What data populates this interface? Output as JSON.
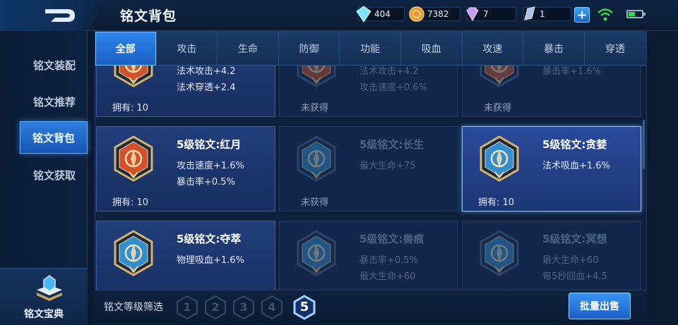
{
  "header": {
    "title": "铭文背包"
  },
  "resources": [
    {
      "icon": "diamond-icon",
      "value": "404"
    },
    {
      "icon": "gold-coin-icon",
      "value": "7382"
    },
    {
      "icon": "gem-icon",
      "value": "7"
    },
    {
      "icon": "crystal-icon",
      "value": "1"
    }
  ],
  "sidebar": {
    "items": [
      {
        "label": "铭文装配"
      },
      {
        "label": "铭文推荐"
      },
      {
        "label": "铭文背包"
      },
      {
        "label": "铭文获取"
      }
    ],
    "codex_label": "铭文宝典"
  },
  "tabs": [
    {
      "label": "全部"
    },
    {
      "label": "攻击"
    },
    {
      "label": "生命"
    },
    {
      "label": "防御"
    },
    {
      "label": "功能"
    },
    {
      "label": "吸血"
    },
    {
      "label": "攻速"
    },
    {
      "label": "暴击"
    },
    {
      "label": "穿透"
    }
  ],
  "cards": [
    {
      "name": "",
      "stats": [
        "法术攻击+4.2",
        "法术穿透+2.4"
      ],
      "owned": "拥有: 10",
      "state": "owned",
      "color": "#d2512a"
    },
    {
      "name": "",
      "stats": [
        "法术攻击+4.2",
        "攻击速度+0.6%"
      ],
      "owned": "未获得",
      "state": "locked",
      "color": "#d2512a"
    },
    {
      "name": "",
      "stats": [
        "暴击率+1.6%"
      ],
      "owned": "未获得",
      "state": "locked",
      "color": "#d2512a"
    },
    {
      "name": "5级铭文:红月",
      "stats": [
        "攻击速度+1.6%",
        "暴击率+0.5%"
      ],
      "owned": "拥有: 10",
      "state": "owned",
      "color": "#d2512a"
    },
    {
      "name": "5级铭文:长生",
      "stats": [
        "最大生命+75"
      ],
      "owned": "未获得",
      "state": "locked",
      "color": "#2f8fd0"
    },
    {
      "name": "5级铭文:贪婪",
      "stats": [
        "法术吸血+1.6%"
      ],
      "owned": "拥有: 10",
      "state": "selected",
      "color": "#2f8fd0"
    },
    {
      "name": "5级铭文:夺萃",
      "stats": [
        "物理吸血+1.6%"
      ],
      "owned": "拥有: 10",
      "state": "owned",
      "color": "#2f8fd0"
    },
    {
      "name": "5级铭文:兽痕",
      "stats": [
        "暴击率+0.5%",
        "最大生命+60"
      ],
      "owned": "未获得",
      "state": "locked",
      "color": "#2f8fd0"
    },
    {
      "name": "5级铭文:冥想",
      "stats": [
        "最大生命+60",
        "每5秒回血+4.5"
      ],
      "owned": "未获得",
      "state": "locked",
      "color": "#2f8fd0"
    }
  ],
  "filter": {
    "label": "铭文等级筛选",
    "levels": [
      "1",
      "2",
      "3",
      "4",
      "5"
    ],
    "selected": "5"
  },
  "sell_button": "批量出售"
}
